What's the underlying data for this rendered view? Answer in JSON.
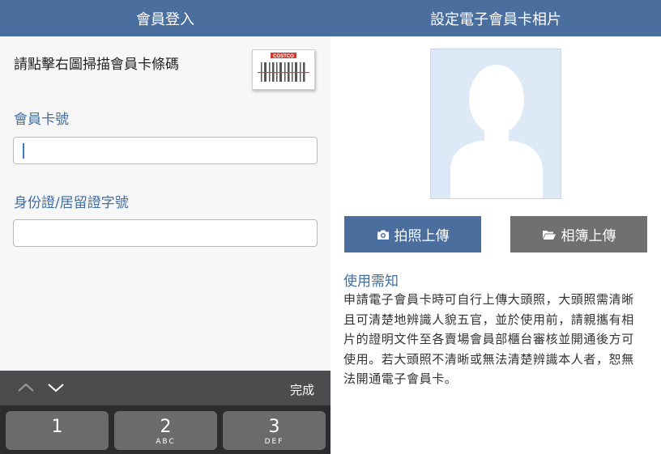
{
  "left_screen": {
    "title": "會員登入",
    "scan_prompt": "請點擊右圖掃描會員卡條碼",
    "barcode_brand": "COSTCO",
    "member_no_label": "會員卡號",
    "member_no_value": "",
    "id_label": "身份證/居留證字號",
    "id_value": "",
    "keyboard": {
      "prev_icon": "chevron-up-icon",
      "next_icon": "chevron-down-icon",
      "done_label": "完成",
      "keys": [
        {
          "num": "1",
          "letters": ""
        },
        {
          "num": "2",
          "letters": "ABC"
        },
        {
          "num": "3",
          "letters": "DEF"
        }
      ]
    }
  },
  "right_screen": {
    "title": "設定電子會員卡相片",
    "placeholder_icon": "person-silhouette-icon",
    "camera_button": "拍照上傳",
    "camera_icon": "camera-icon",
    "album_button": "相簿上傳",
    "album_icon": "folder-open-icon",
    "notice_title": "使用需知",
    "notice_lines": [
      "申請電子會員卡時可自行上傳大頭照，大頭照需清晰",
      "且可清楚地辨識人貌五官，並於使用前，請親攜有相",
      "片的證明文件至各賣場會員部櫃台審核並開通後方可",
      "使用。若大頭照不清晰或無法清楚辨識本人者，恕無",
      "法開通電子會員卡。"
    ]
  },
  "colors": {
    "header_blue": "#4a6e9e",
    "label_blue": "#3f6ea3",
    "album_gray": "#707070",
    "keyboard_dark": "#2c2c2e"
  }
}
